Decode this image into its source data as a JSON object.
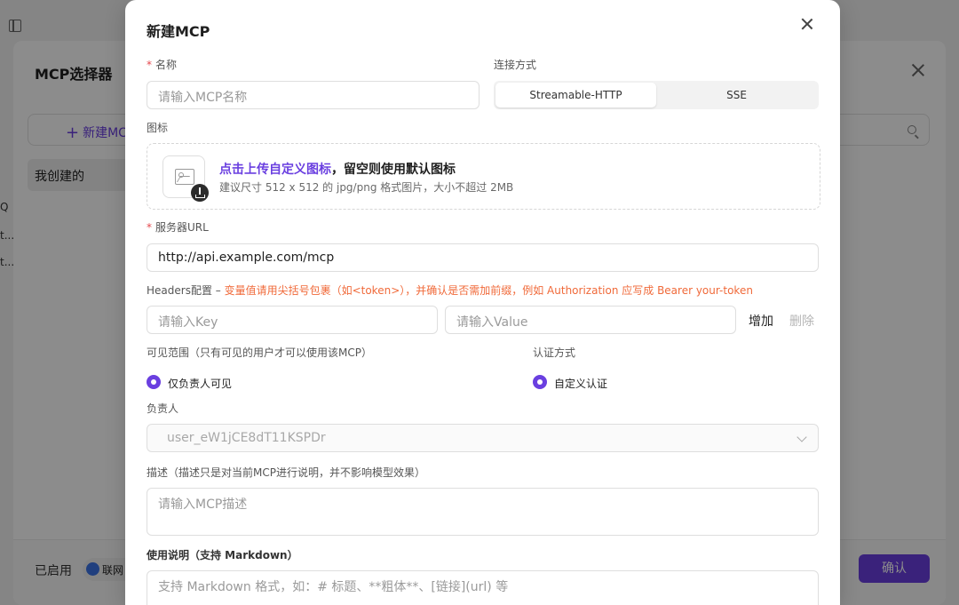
{
  "background": {
    "picker_title": "MCP选择器",
    "new_button_label": "新建MC",
    "tab_mine": "我创建的",
    "enabled_label": "已启用",
    "chip_label": "联网",
    "confirm_label": "确认",
    "left_fragments": [
      "Q",
      "t...",
      "t..."
    ]
  },
  "modal": {
    "title": "新建MCP",
    "name": {
      "label": "名称",
      "required_mark": "*",
      "placeholder": "请输入MCP名称"
    },
    "connection": {
      "label": "连接方式",
      "options": [
        "Streamable-HTTP",
        "SSE"
      ],
      "selected": "Streamable-HTTP"
    },
    "icon": {
      "label": "图标",
      "upload_link": "点击上传自定义图标",
      "upload_rest": "，留空则使用默认图标",
      "upload_hint": "建议尺寸 512 x 512 的 jpg/png 格式图片，大小不超过 2MB"
    },
    "server_url": {
      "label": "服务器URL",
      "required_mark": "*",
      "value": "http://api.example.com/mcp"
    },
    "headers": {
      "label": "Headers配置 – ",
      "warning": "变量值请用尖括号包裹（如<token>），并确认是否需加前缀，例如 Authorization 应写成 Bearer your-token",
      "key_placeholder": "请输入Key",
      "value_placeholder": "请输入Value",
      "add_label": "增加",
      "delete_label": "删除"
    },
    "visibility": {
      "label": "可见范围（只有可见的用户才可以使用该MCP）",
      "option": "仅负责人可见"
    },
    "auth": {
      "label": "认证方式",
      "option": "自定义认证"
    },
    "owner": {
      "label": "负责人",
      "value": "user_eW1jCE8dT11KSPDr"
    },
    "description": {
      "label": "描述（描述只是对当前MCP进行说明，并不影响模型效果）",
      "placeholder": "请输入MCP描述"
    },
    "usage": {
      "label": "使用说明（支持 Markdown）",
      "placeholder": "支持 Markdown 格式，如：# 标题、**粗体**、[链接](url) 等"
    }
  },
  "colors": {
    "accent": "#6a3fe0",
    "required": "#e5484d",
    "warning": "#f06a3a"
  }
}
